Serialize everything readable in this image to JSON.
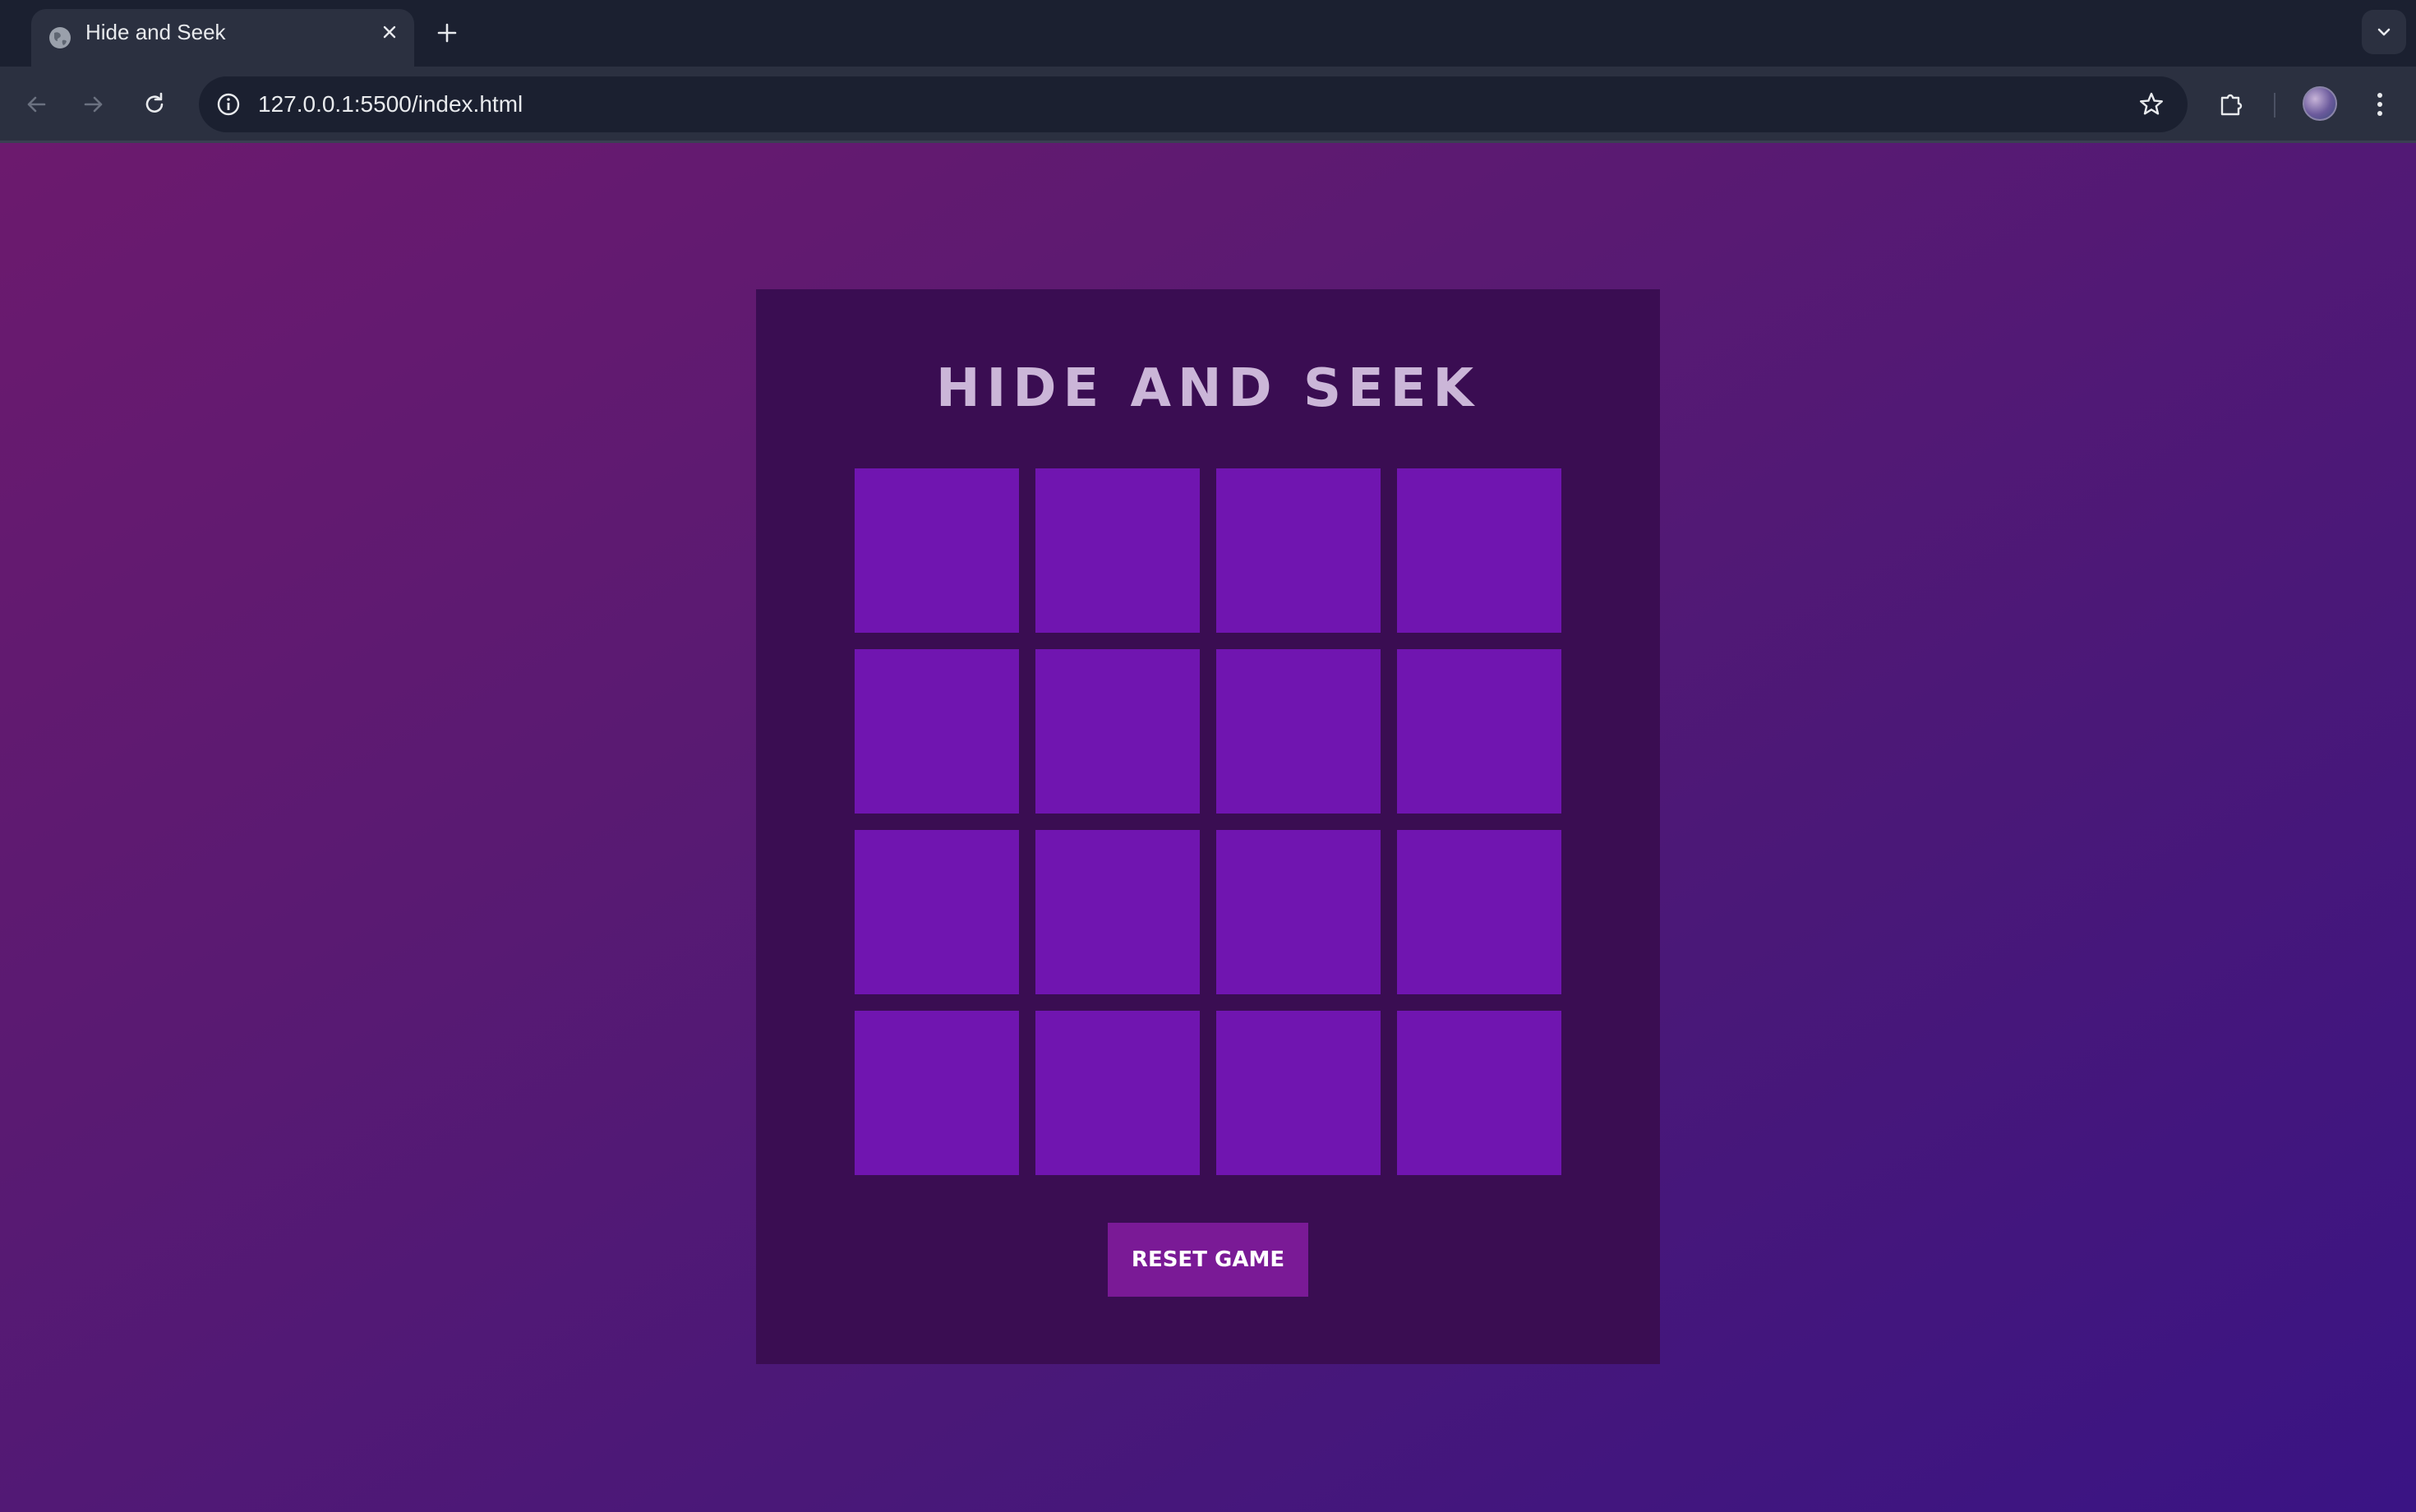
{
  "browser": {
    "tab": {
      "title": "Hide and Seek",
      "favicon": "globe-icon",
      "close_icon": "close-icon"
    },
    "new_tab_icon": "plus-icon",
    "tab_search_icon": "chevron-down-icon",
    "toolbar": {
      "back_icon": "arrow-left-icon",
      "forward_icon": "arrow-right-icon",
      "reload_icon": "reload-icon",
      "site_info_icon": "info-icon",
      "url": "127.0.0.1:5500/index.html",
      "bookmark_icon": "star-icon",
      "extensions_icon": "puzzle-icon",
      "menu_icon": "kebab-menu-icon"
    }
  },
  "game": {
    "title": "HIDE AND SEEK",
    "grid_rows": 4,
    "grid_cols": 4,
    "reset_label": "RESET GAME"
  },
  "colors": {
    "browser_frame": "#1b2030",
    "toolbar": "#2b3040",
    "panel": "#3a0d52",
    "cell": "#7015b0",
    "reset_button": "#7a1a96",
    "title_text": "#cbb6d8"
  }
}
